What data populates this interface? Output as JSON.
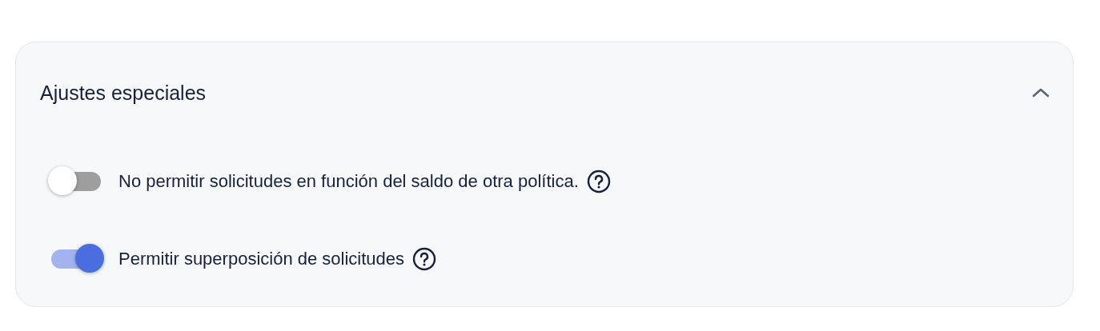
{
  "section": {
    "title": "Ajustes especiales",
    "expanded": true,
    "settings": [
      {
        "label": "No permitir solicitudes en función del saldo de otra política.",
        "on": false
      },
      {
        "label": "Permitir superposición de solicitudes",
        "on": true
      }
    ]
  }
}
